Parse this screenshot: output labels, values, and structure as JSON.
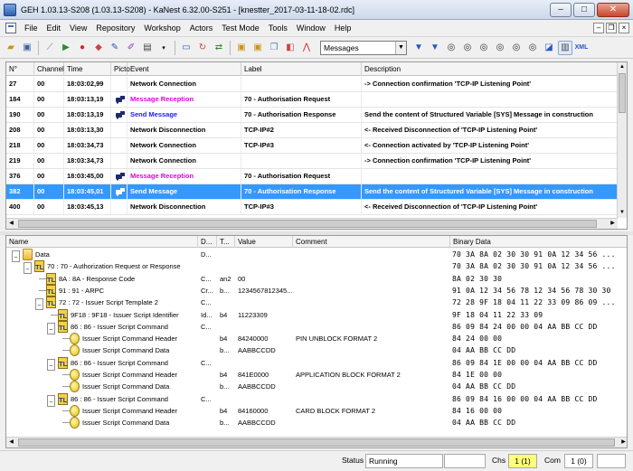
{
  "window": {
    "title": "GEH 1.03.13-S208 (1.03.13-S208) - KaNest 6.32.00-S251 - [knestter_2017-03-11-18-02.rdc]"
  },
  "menu": [
    "File",
    "Edit",
    "View",
    "Repository",
    "Workshop",
    "Actors",
    "Test Mode",
    "Tools",
    "Window",
    "Help"
  ],
  "toolbar": {
    "filter_value": "Messages"
  },
  "events": {
    "headers": {
      "no": "N°",
      "channel": "Channel",
      "time": "Time",
      "picto": "Picto",
      "event": "Event",
      "label": "Label",
      "description": "Description"
    },
    "rows": [
      {
        "no": "27",
        "channel": "00",
        "time": "18:03:02,99",
        "event": "Network Connection",
        "label": "",
        "description": "-> Connection confirmation 'TCP-IP Listening Point'",
        "icon": "",
        "color": "#000000"
      },
      {
        "no": "184",
        "channel": "00",
        "time": "18:03:13,19",
        "event": "Message Reception",
        "label": "70 - Authorisation Request",
        "description": "",
        "icon": "card-reader-icon",
        "color": "#e000e0"
      },
      {
        "no": "190",
        "channel": "00",
        "time": "18:03:13,19",
        "event": "Send Message",
        "label": "70 - Authorisation Response",
        "description": "Send the content of Structured Variable [SYS] Message in construction",
        "icon": "card-reader-icon",
        "color": "#1a1aff"
      },
      {
        "no": "208",
        "channel": "00",
        "time": "18:03:13,30",
        "event": "Network Disconnection",
        "label": "TCP-IP#2",
        "description": "<- Received Disconnection of 'TCP-IP Listening Point'",
        "icon": "",
        "color": "#000000"
      },
      {
        "no": "218",
        "channel": "00",
        "time": "18:03:34,73",
        "event": "Network Connection",
        "label": "TCP-IP#3",
        "description": "<- Connection activated by 'TCP-IP Listening Point'",
        "icon": "",
        "color": "#000000"
      },
      {
        "no": "219",
        "channel": "00",
        "time": "18:03:34,73",
        "event": "Network Connection",
        "label": "",
        "description": "-> Connection confirmation 'TCP-IP Listening Point'",
        "icon": "",
        "color": "#000000"
      },
      {
        "no": "376",
        "channel": "00",
        "time": "18:03:45,00",
        "event": "Message Reception",
        "label": "70 - Authorisation Request",
        "description": "",
        "icon": "card-reader-icon",
        "color": "#e000e0"
      },
      {
        "no": "382",
        "channel": "00",
        "time": "18:03:45,01",
        "event": "Send Message",
        "label": "70 - Authorisation Response",
        "description": "Send the content of Structured Variable [SYS] Message in construction",
        "icon": "card-reader-icon",
        "color": "#ffffff",
        "selected": true
      },
      {
        "no": "400",
        "channel": "00",
        "time": "18:03:45,13",
        "event": "Network Disconnection",
        "label": "TCP-IP#3",
        "description": "<- Received Disconnection of 'TCP-IP Listening Point'",
        "icon": "",
        "color": "#000000"
      }
    ]
  },
  "tree": {
    "headers": {
      "name": "Name",
      "d": "D...",
      "t": "T...",
      "value": "Value",
      "comment": "Comment",
      "binary": "Binary Data"
    },
    "rows": [
      {
        "depth": 0,
        "kind": "folder",
        "expander": "-",
        "name": "Data",
        "d": "D...",
        "t": "",
        "value": "",
        "comment": "",
        "binary": "70 3A 8A 02 30 30 91 0A 12 34 56 ..."
      },
      {
        "depth": 1,
        "kind": "tlv",
        "expander": "-",
        "name": "70 : 70 - Authorization Request or Response",
        "d": "",
        "t": "",
        "value": "",
        "comment": "",
        "binary": "70 3A 8A 02 30 30 91 0A 12 34 56 ..."
      },
      {
        "depth": 2,
        "kind": "tlv",
        "expander": "",
        "name": "8A : 8A - Response Code",
        "d": "C...",
        "t": "an2",
        "value": "00",
        "comment": "",
        "binary": "8A 02 30 30"
      },
      {
        "depth": 2,
        "kind": "tlv",
        "expander": "",
        "name": "91 : 91 - ARPC",
        "d": "Cr...",
        "t": "b...",
        "value": "1234567812345...",
        "comment": "",
        "binary": "91 0A 12 34 56 78 12 34 56 78 30 30"
      },
      {
        "depth": 2,
        "kind": "tlv",
        "expander": "-",
        "name": "72 : 72 - Issuer Script Template 2",
        "d": "C...",
        "t": "",
        "value": "",
        "comment": "",
        "binary": "72 28 9F 18 04 11 22 33 09 86 09 ..."
      },
      {
        "depth": 3,
        "kind": "tlv",
        "expander": "",
        "name": "9F18 : 9F18 - Issuer Script Identifier",
        "d": "Id...",
        "t": "b4",
        "value": "11223309",
        "comment": "",
        "binary": "9F 18 04 11 22 33 09"
      },
      {
        "depth": 3,
        "kind": "tlv",
        "expander": "-",
        "name": "86 : 86 - Issuer Script Command",
        "d": "C...",
        "t": "",
        "value": "",
        "comment": "",
        "binary": "86 09 84 24 00 00 04 AA BB CC DD"
      },
      {
        "depth": 4,
        "kind": "leaf",
        "expander": "",
        "name": "Issuer Script Command Header",
        "d": "",
        "t": "b4",
        "value": "84240000",
        "comment": "PIN UNBLOCK FORMAT 2",
        "binary": "84 24 00 00"
      },
      {
        "depth": 4,
        "kind": "leaf",
        "expander": "",
        "name": "Issuer Script Command Data",
        "d": "",
        "t": "b...",
        "value": "AABBCCDD",
        "comment": "",
        "binary": "04 AA BB CC DD"
      },
      {
        "depth": 3,
        "kind": "tlv",
        "expander": "-",
        "name": "86 : 86 - Issuer Script Command",
        "d": "C...",
        "t": "",
        "value": "",
        "comment": "",
        "binary": "86 09 84 1E 00 00 04 AA BB CC DD"
      },
      {
        "depth": 4,
        "kind": "leaf",
        "expander": "",
        "name": "Issuer Script Command Header",
        "d": "",
        "t": "b4",
        "value": "841E0000",
        "comment": "APPLICATION BLOCK FORMAT 2",
        "binary": "84 1E 00 00"
      },
      {
        "depth": 4,
        "kind": "leaf",
        "expander": "",
        "name": "Issuer Script Command Data",
        "d": "",
        "t": "b...",
        "value": "AABBCCDD",
        "comment": "",
        "binary": "04 AA BB CC DD"
      },
      {
        "depth": 3,
        "kind": "tlv",
        "expander": "-",
        "name": "86 : 86 - Issuer Script Command",
        "d": "C...",
        "t": "",
        "value": "",
        "comment": "",
        "binary": "86 09 84 16 00 00 04 AA BB CC DD"
      },
      {
        "depth": 4,
        "kind": "leaf",
        "expander": "",
        "name": "Issuer Script Command Header",
        "d": "",
        "t": "b4",
        "value": "84160000",
        "comment": "CARD BLOCK FORMAT 2",
        "binary": "84 16 00 00"
      },
      {
        "depth": 4,
        "kind": "leaf",
        "expander": "",
        "name": "Issuer Script Command Data",
        "d": "",
        "t": "b...",
        "value": "AABBCCDD",
        "comment": "",
        "binary": "04 AA BB CC DD"
      }
    ]
  },
  "status": {
    "status_label": "Status",
    "status_value": "Running",
    "chs_label": "Chs",
    "chs_value": "1 (1)",
    "com_label": "Com",
    "com_value": "1 (0)"
  },
  "colors": {
    "selection": "#3399ff",
    "reception": "#e000e0",
    "send": "#1a1aff",
    "status_highlight": "#ffff7a"
  }
}
